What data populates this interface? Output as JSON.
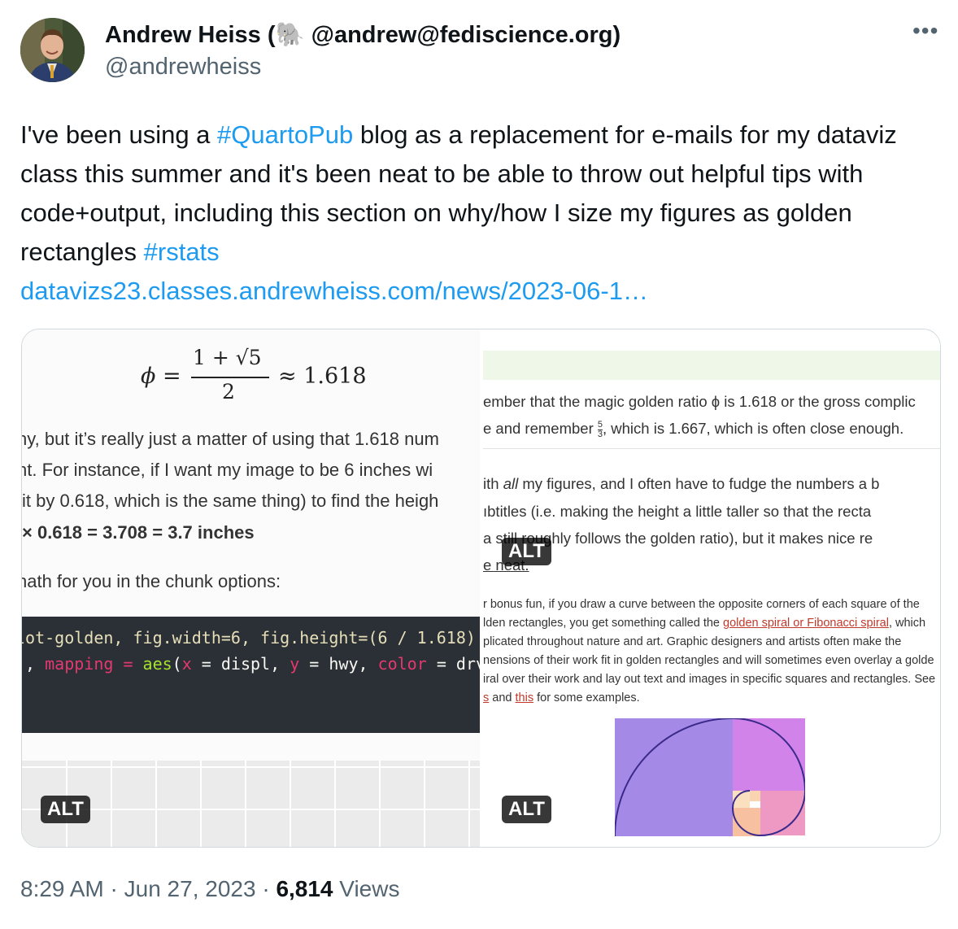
{
  "author": {
    "display_name_prefix": "Andrew Heiss (",
    "display_name_emoji": "🐘",
    "display_name_suffix": " @andrew@fediscience.org)",
    "handle": "@andrewheiss"
  },
  "more_icon": "•••",
  "tweet": {
    "t1": "I've been using a ",
    "hashtag1": "#QuartoPub",
    "t2": " blog as a replacement for e-mails for my dataviz class this summer and it's been neat to be able to throw out helpful tips with code+output, including this section on why/how I size my figures as golden rectangles ",
    "hashtag2": "#rstats",
    "url": "datavizs23.classes.andrewheiss.com/news/2023-06-1…"
  },
  "media_left": {
    "formula_phi": "ϕ",
    "formula_eq": "=",
    "formula_num": "1 + √5",
    "formula_den": "2",
    "formula_approx": "≈ 1.618",
    "line1": "ny, but it’s really just a matter of using that 1.618 num",
    "line2": "nt. For instance, if I want my image to be 6 inches wi",
    "line3": "it by 0.618, which is the same thing) to find the heigh",
    "line4": "× 0.618 = 3.708 = 3.7 inches",
    "line5": "nath for you in the chunk options:",
    "code1": "lot-golden, fig.width=6, fig.height=(6 / 1.618)",
    "code2_a": "), ",
    "code2_mapping": "mapping",
    "code2_b": " = ",
    "code2_aes": "aes",
    "code2_c": "(",
    "code2_x": "x",
    "code2_d": " = displ, ",
    "code2_y": "y",
    "code2_e": " = hwy, ",
    "code2_color": "color",
    "code2_f": " = drv",
    "alt": "ALT"
  },
  "media_right": {
    "line1": "ember that the magic golden ratio ϕ is 1.618 or the gross complic",
    "line2_a": "e and remember ",
    "line2_frac_num": "5",
    "line2_frac_den": "3",
    "line2_b": ", which is 1.667, which is often close enough.",
    "line3_a": "ith ",
    "line3_em": "all",
    "line3_b": " my figures, and I often have to fudge the numbers a b",
    "line4": "ıbtitles (i.e. making the height a little taller so that the recta",
    "line5": "a still roughly follows the golden ratio), but it makes nice re",
    "line6": "e neat.",
    "s1": "r bonus fun, if you draw a curve between the opposite corners of each square of the",
    "s2_a": "lden rectangles, you get something called the ",
    "s2_link": "golden spiral or Fibonacci spiral",
    "s2_b": ", which",
    "s3": "plicated throughout nature and art. Graphic designers and artists often make the",
    "s4": "nensions of their work fit in golden rectangles and will sometimes even overlay a golde",
    "s5": "iral over their work and lay out text and images in specific squares and rectangles. See",
    "s6_link1": "s",
    "s6_a": " and ",
    "s6_link2": "this",
    "s6_b": " for some examples.",
    "alt_top": "ALT",
    "alt_bottom": "ALT"
  },
  "footer": {
    "time": "8:29 AM",
    "sep1": " · ",
    "date": "Jun 27, 2023",
    "sep2": " · ",
    "views_count": "6,814",
    "views_label": " Views"
  },
  "colors": {
    "link_blue": "#1d9bf0",
    "code_bg": "#2b2f36",
    "code_pink": "#e5386e",
    "code_green": "#a6e22e",
    "spiral_purple": "#a48ae6",
    "spiral_magenta": "#d183ea",
    "spiral_pink": "#ee99c4",
    "spiral_peach": "#f7c0a0"
  }
}
